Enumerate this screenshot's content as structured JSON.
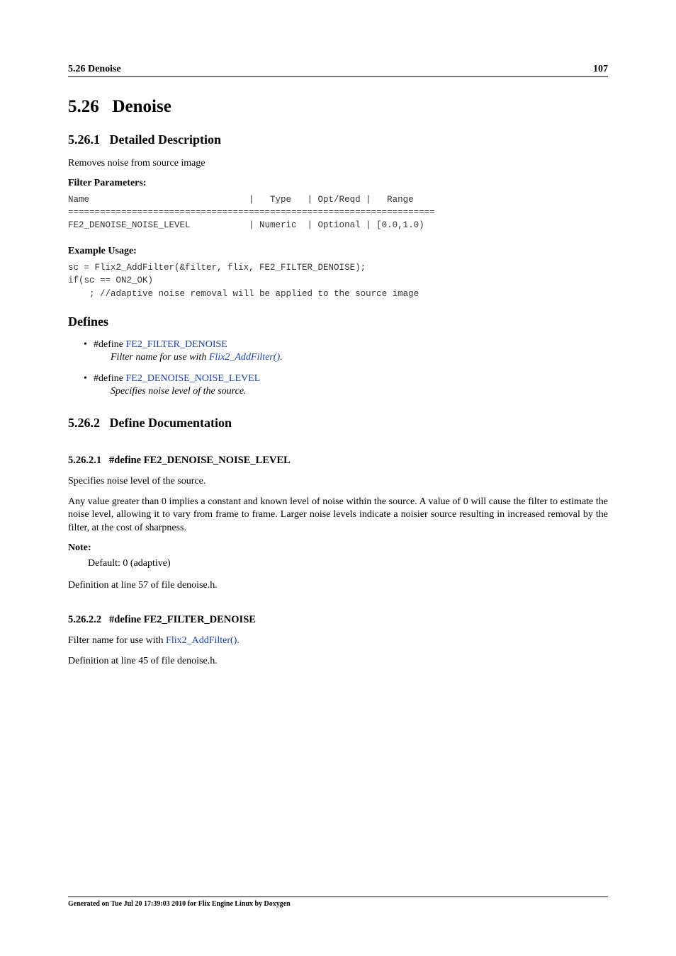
{
  "header": {
    "left": "5.26 Denoise",
    "right": "107"
  },
  "section": {
    "number": "5.26",
    "title": "Denoise"
  },
  "detailed": {
    "number": "5.26.1",
    "title": "Detailed Description",
    "intro": "Removes noise from source image",
    "filter_params_label": "Filter Parameters:",
    "table_l1": "Name                              |   Type   | Opt/Reqd |   Range",
    "table_l2": "=====================================================================",
    "table_l3": "FE2_DENOISE_NOISE_LEVEL           | Numeric  | Optional | [0.0,1.0)",
    "example_label": "Example Usage:",
    "code_l1": "sc = Flix2_AddFilter(&filter, flix, FE2_FILTER_DENOISE);",
    "code_l2": "if(sc == ON2_OK)",
    "code_l3": "    ; //adaptive noise removal will be applied to the source image"
  },
  "defines": {
    "heading": "Defines",
    "items": [
      {
        "prefix": "#define ",
        "name": "FE2_FILTER_DENOISE",
        "desc_before": "Filter name for use with ",
        "desc_link": "Flix2_AddFilter()",
        "desc_after": "."
      },
      {
        "prefix": "#define ",
        "name": "FE2_DENOISE_NOISE_LEVEL",
        "desc_full": "Specifies noise level of the source."
      }
    ]
  },
  "definedoc": {
    "number": "5.26.2",
    "title": "Define Documentation",
    "sub1": {
      "number": "5.26.2.1",
      "title": "#define FE2_DENOISE_NOISE_LEVEL",
      "p1": "Specifies noise level of the source.",
      "p2": "Any value greater than 0 implies a constant and known level of noise within the source. A value of 0 will cause the filter to estimate the noise level, allowing it to vary from frame to frame. Larger noise levels indicate a noisier source resulting in increased removal by the filter, at the cost of sharpness.",
      "note_label": "Note:",
      "note_body": "Default: 0 (adaptive)",
      "defline": "Definition at line 57 of file denoise.h."
    },
    "sub2": {
      "number": "5.26.2.2",
      "title": "#define FE2_FILTER_DENOISE",
      "p_before": "Filter name for use with ",
      "p_link": "Flix2_AddFilter().",
      "defline": "Definition at line 45 of file denoise.h."
    }
  },
  "footer": "Generated on Tue Jul 20 17:39:03 2010 for Flix Engine Linux by Doxygen"
}
